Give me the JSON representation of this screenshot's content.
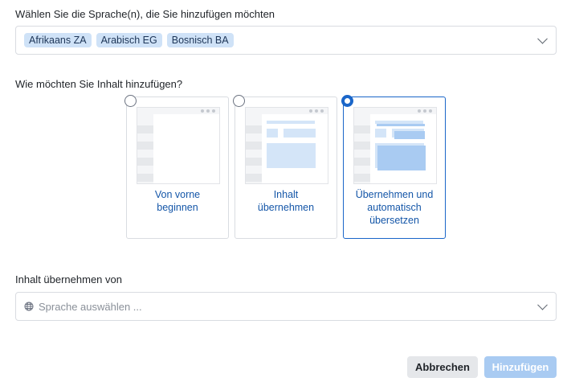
{
  "languages": {
    "label": "Wählen Sie die Sprache(n), die Sie hinzufügen möchten",
    "tags": [
      "Afrikaans ZA",
      "Arabisch EG",
      "Bosnisch BA"
    ]
  },
  "content": {
    "question": "Wie möchten Sie Inhalt hinzufügen?",
    "options": [
      {
        "line1": "Von vorne",
        "line2": "beginnen",
        "line3": "",
        "selected": false
      },
      {
        "line1": "Inhalt",
        "line2": "übernehmen",
        "line3": "",
        "selected": false
      },
      {
        "line1": "Übernehmen und",
        "line2": "automatisch",
        "line3": "übersetzen",
        "selected": true
      }
    ]
  },
  "source": {
    "label": "Inhalt übernehmen von",
    "placeholder": "Sprache auswählen ...",
    "icon": "globe-icon"
  },
  "actions": {
    "cancel_label": "Abbrechen",
    "add_label": "Hinzufügen"
  },
  "colors": {
    "accent": "#1a66c9",
    "tag_bg": "#cfe2f7",
    "disabled_primary": "#a9cbf2"
  }
}
